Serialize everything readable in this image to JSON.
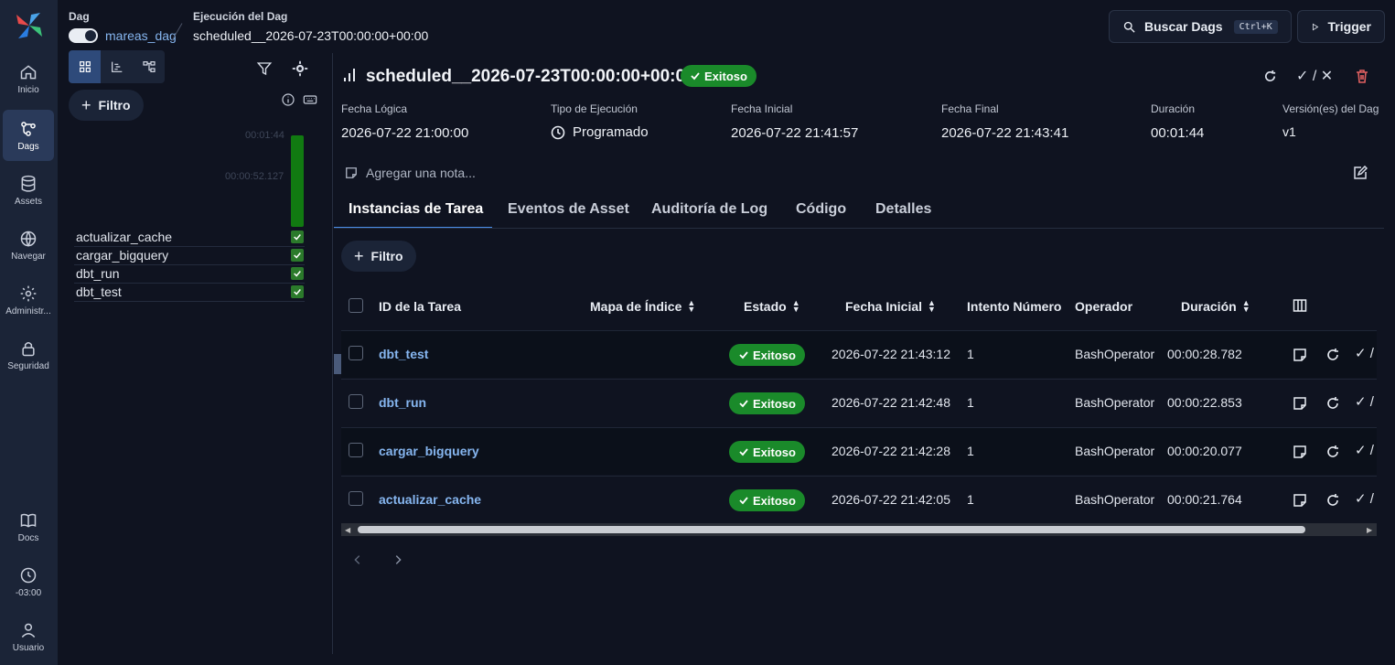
{
  "nav": {
    "items": [
      {
        "label": "Inicio",
        "icon": "home-icon"
      },
      {
        "label": "Dags",
        "icon": "dags-icon"
      },
      {
        "label": "Assets",
        "icon": "database-icon"
      },
      {
        "label": "Navegar",
        "icon": "globe-icon"
      },
      {
        "label": "Administr...",
        "icon": "gear-icon"
      },
      {
        "label": "Seguridad",
        "icon": "lock-icon"
      }
    ],
    "bottom": [
      {
        "label": "Docs",
        "icon": "book-icon"
      },
      {
        "label": "-03:00",
        "icon": "clock-icon"
      },
      {
        "label": "Usuario",
        "icon": "user-icon"
      }
    ]
  },
  "breadcrumb": {
    "dag_label": "Dag",
    "dag_name": "mareas_dag",
    "run_label": "Ejecución del Dag",
    "run_name": "scheduled__2026-07-23T00:00:00+00:00"
  },
  "header": {
    "search_label": "Buscar Dags",
    "search_shortcut": "Ctrl+K",
    "trigger_label": "Trigger"
  },
  "left_panel": {
    "filter_label": "Filtro",
    "duration_max": "00:01:44",
    "duration_mid": "00:00:52.127",
    "tasks": [
      "actualizar_cache",
      "cargar_bigquery",
      "dbt_run",
      "dbt_test"
    ]
  },
  "run": {
    "title": "scheduled__2026-07-23T00:00:00+00:00",
    "status": "Exitoso",
    "meta": [
      {
        "label": "Fecha Lógica",
        "value": "2026-07-22 21:00:00"
      },
      {
        "label": "Tipo de Ejecución",
        "value": "Programado"
      },
      {
        "label": "Fecha Inicial",
        "value": "2026-07-22 21:41:57"
      },
      {
        "label": "Fecha Final",
        "value": "2026-07-22 21:43:41"
      },
      {
        "label": "Duración",
        "value": "00:01:44"
      },
      {
        "label": "Versión(es) del Dag",
        "value": "v1"
      }
    ],
    "note_placeholder": "Agregar una nota..."
  },
  "tabs": [
    "Instancias de Tarea",
    "Eventos de Asset",
    "Auditoría de Log",
    "Código",
    "Detalles"
  ],
  "table": {
    "filter_label": "Filtro",
    "headers": [
      "ID de la Tarea",
      "Mapa de Índice",
      "Estado",
      "Fecha Inicial",
      "Intento Número",
      "Operador",
      "Duración"
    ],
    "rows": [
      {
        "id": "dbt_test",
        "status": "Exitoso",
        "start": "2026-07-22 21:43:12",
        "try": "1",
        "operator": "BashOperator",
        "duration": "00:00:28.782"
      },
      {
        "id": "dbt_run",
        "status": "Exitoso",
        "start": "2026-07-22 21:42:48",
        "try": "1",
        "operator": "BashOperator",
        "duration": "00:00:22.853"
      },
      {
        "id": "cargar_bigquery",
        "status": "Exitoso",
        "start": "2026-07-22 21:42:28",
        "try": "1",
        "operator": "BashOperator",
        "duration": "00:00:20.077"
      },
      {
        "id": "actualizar_cache",
        "status": "Exitoso",
        "start": "2026-07-22 21:42:05",
        "try": "1",
        "operator": "BashOperator",
        "duration": "00:00:21.764"
      }
    ]
  },
  "colors": {
    "success": "#1a8a2a",
    "link": "#86b6f0",
    "nav_bg": "#1b2437"
  }
}
